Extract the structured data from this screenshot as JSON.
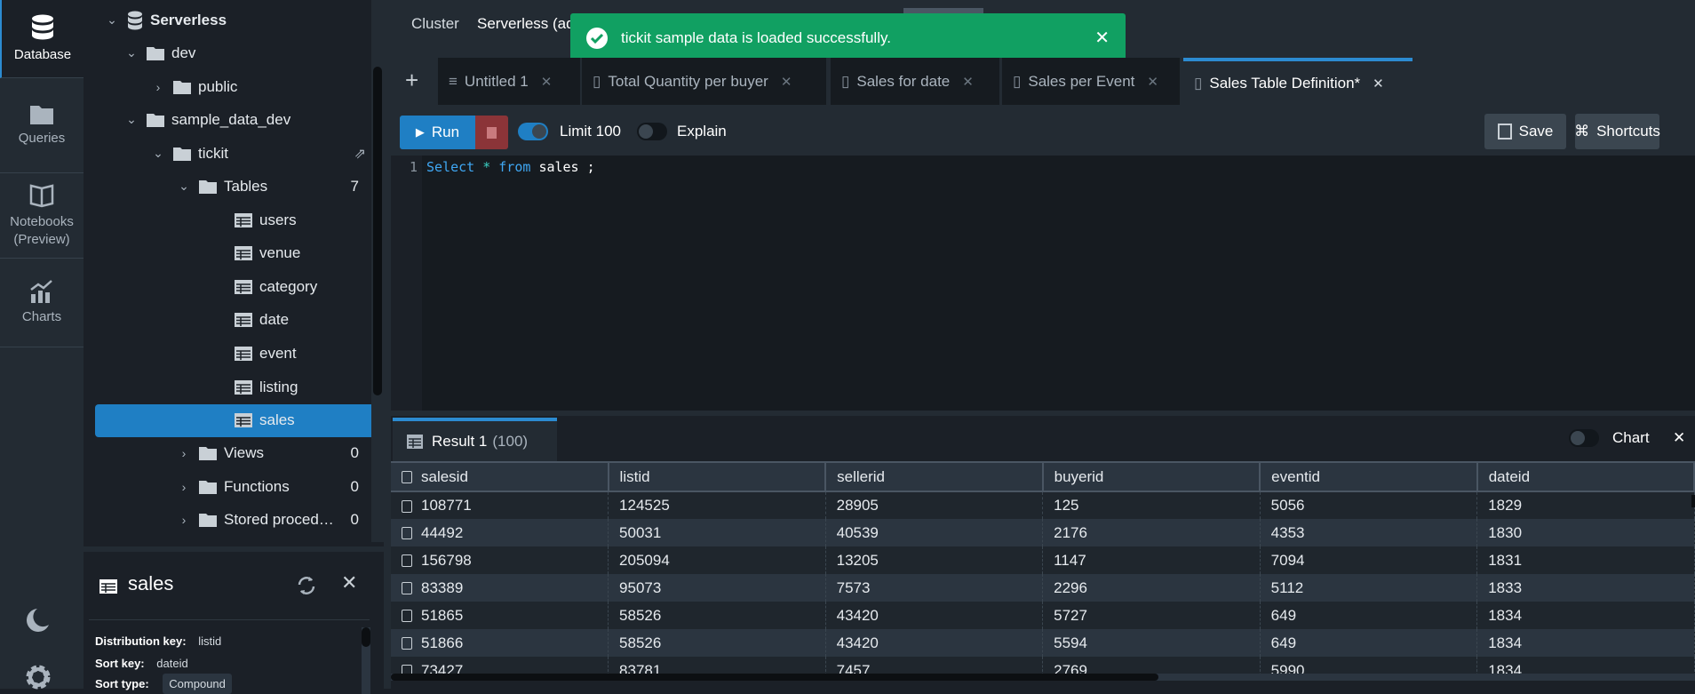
{
  "rail": {
    "items": [
      {
        "label": "Database",
        "icon": "database-icon"
      },
      {
        "label": "Queries",
        "icon": "folder-icon"
      },
      {
        "label": "Notebooks (Preview)",
        "icon": "book-icon"
      },
      {
        "label": "Charts",
        "icon": "chart-icon"
      }
    ]
  },
  "tree": {
    "root": "Serverless",
    "dev": "dev",
    "public": "public",
    "sample": "sample_data_dev",
    "tickit": "tickit",
    "tables": "Tables",
    "tables_count": "7",
    "table_items": [
      "users",
      "venue",
      "category",
      "date",
      "event",
      "listing",
      "sales"
    ],
    "selected": "sales",
    "views": "Views",
    "views_count": "0",
    "functions": "Functions",
    "functions_count": "0",
    "procs": "Stored proced…",
    "procs_count": "0"
  },
  "details": {
    "title": "sales",
    "dist_label": "Distribution key:",
    "dist_value": "listid",
    "sort_label": "Sort key:",
    "sort_value": "dateid",
    "type_label": "Sort type:",
    "type_value": "Compound"
  },
  "header": {
    "cluster_label": "Cluster",
    "cluster_value": "Serverless (ad"
  },
  "toast": {
    "message": "tickit sample data is loaded successfully.",
    "color": "#11a062"
  },
  "tabs": [
    {
      "label": "Untitled 1"
    },
    {
      "label": "Total Quantity per buyer"
    },
    {
      "label": "Sales for date"
    },
    {
      "label": "Sales per Event"
    },
    {
      "label": "Sales Table Definition*",
      "active": true
    }
  ],
  "toolbar": {
    "run": "Run",
    "limit": "Limit 100",
    "limit_on": true,
    "explain": "Explain",
    "explain_on": false,
    "save": "Save",
    "shortcuts": "Shortcuts"
  },
  "editor": {
    "line": "1",
    "kw1": "Select",
    "star": "*",
    "kw2": "from",
    "rest": "sales ;"
  },
  "results": {
    "tab": "Result 1",
    "count": "(100)",
    "chart": "Chart",
    "columns": [
      "salesid",
      "listid",
      "sellerid",
      "buyerid",
      "eventid",
      "dateid"
    ],
    "rows": [
      [
        "108771",
        "124525",
        "28905",
        "125",
        "5056",
        "1829"
      ],
      [
        "44492",
        "50031",
        "40539",
        "2176",
        "4353",
        "1830"
      ],
      [
        "156798",
        "205094",
        "13205",
        "1147",
        "7094",
        "1831"
      ],
      [
        "83389",
        "95073",
        "7573",
        "2296",
        "5112",
        "1833"
      ],
      [
        "51865",
        "58526",
        "43420",
        "5727",
        "649",
        "1834"
      ],
      [
        "51866",
        "58526",
        "43420",
        "5594",
        "649",
        "1834"
      ],
      [
        "73427",
        "83781",
        "7457",
        "2769",
        "5990",
        "1834"
      ]
    ]
  },
  "colors": {
    "accent": "#2c8bd1",
    "selected": "#1f7fc4",
    "stop": "#8b3438",
    "success": "#11a062"
  }
}
